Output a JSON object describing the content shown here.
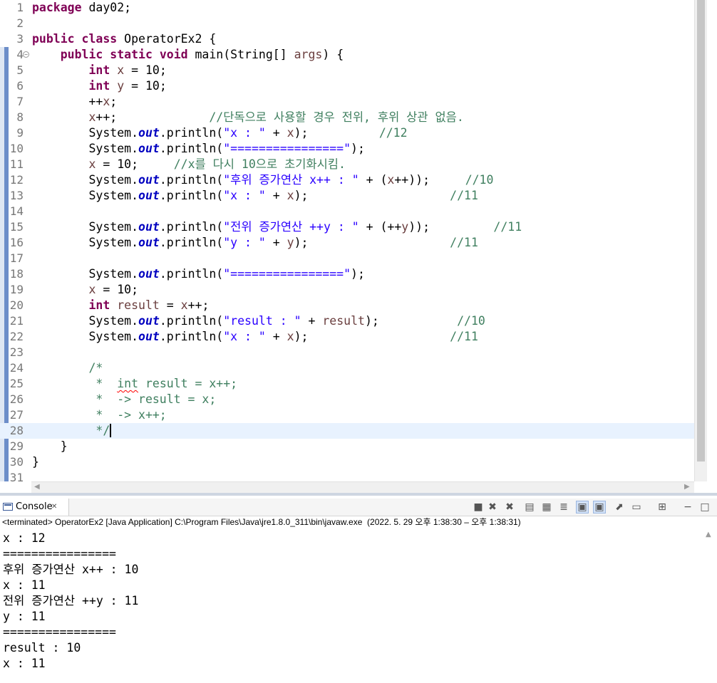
{
  "editor": {
    "lines": [
      {
        "n": "1",
        "segs": [
          [
            "kw",
            "package"
          ],
          [
            "p",
            " day02;"
          ]
        ]
      },
      {
        "n": "2",
        "segs": []
      },
      {
        "n": "3",
        "segs": [
          [
            "kw",
            "public class"
          ],
          [
            "p",
            " OperatorEx2 {"
          ]
        ]
      },
      {
        "n": "4",
        "fold": true,
        "segs": [
          [
            "p",
            "    "
          ],
          [
            "kw",
            "public static void"
          ],
          [
            "p",
            " main(String[] "
          ],
          [
            "var",
            "args"
          ],
          [
            "p",
            ") {"
          ]
        ]
      },
      {
        "n": "5",
        "segs": [
          [
            "p",
            "        "
          ],
          [
            "kw",
            "int"
          ],
          [
            "p",
            " "
          ],
          [
            "var",
            "x"
          ],
          [
            "p",
            " = 10;"
          ]
        ]
      },
      {
        "n": "6",
        "segs": [
          [
            "p",
            "        "
          ],
          [
            "kw",
            "int"
          ],
          [
            "p",
            " "
          ],
          [
            "var",
            "y"
          ],
          [
            "p",
            " = 10;"
          ]
        ]
      },
      {
        "n": "7",
        "segs": [
          [
            "p",
            "        ++"
          ],
          [
            "var",
            "x"
          ],
          [
            "p",
            ";"
          ]
        ]
      },
      {
        "n": "8",
        "segs": [
          [
            "p",
            "        "
          ],
          [
            "var",
            "x"
          ],
          [
            "p",
            "++;             "
          ],
          [
            "cm",
            "//단독으로 사용할 경우 전위, 후위 상관 없음."
          ]
        ]
      },
      {
        "n": "9",
        "segs": [
          [
            "p",
            "        System."
          ],
          [
            "fld",
            "out"
          ],
          [
            "p",
            ".println("
          ],
          [
            "str",
            "\"x : \""
          ],
          [
            "p",
            " + "
          ],
          [
            "var",
            "x"
          ],
          [
            "p",
            ");          "
          ],
          [
            "cm",
            "//12"
          ]
        ]
      },
      {
        "n": "10",
        "segs": [
          [
            "p",
            "        System."
          ],
          [
            "fld",
            "out"
          ],
          [
            "p",
            ".println("
          ],
          [
            "str",
            "\"================\""
          ],
          [
            "p",
            ");"
          ]
        ]
      },
      {
        "n": "11",
        "segs": [
          [
            "p",
            "        "
          ],
          [
            "var",
            "x"
          ],
          [
            "p",
            " = 10;     "
          ],
          [
            "cm",
            "//x를 다시 10으로 초기화시킴."
          ]
        ]
      },
      {
        "n": "12",
        "segs": [
          [
            "p",
            "        System."
          ],
          [
            "fld",
            "out"
          ],
          [
            "p",
            ".println("
          ],
          [
            "str",
            "\"후위 증가연산 x++ : \""
          ],
          [
            "p",
            " + ("
          ],
          [
            "var",
            "x"
          ],
          [
            "p",
            "++));     "
          ],
          [
            "cm",
            "//10"
          ]
        ]
      },
      {
        "n": "13",
        "segs": [
          [
            "p",
            "        System."
          ],
          [
            "fld",
            "out"
          ],
          [
            "p",
            ".println("
          ],
          [
            "str",
            "\"x : \""
          ],
          [
            "p",
            " + "
          ],
          [
            "var",
            "x"
          ],
          [
            "p",
            ");                    "
          ],
          [
            "cm",
            "//11"
          ]
        ]
      },
      {
        "n": "14",
        "segs": []
      },
      {
        "n": "15",
        "segs": [
          [
            "p",
            "        System."
          ],
          [
            "fld",
            "out"
          ],
          [
            "p",
            ".println("
          ],
          [
            "str",
            "\"전위 증가연산 ++y : \""
          ],
          [
            "p",
            " + (++"
          ],
          [
            "var",
            "y"
          ],
          [
            "p",
            "));         "
          ],
          [
            "cm",
            "//11"
          ]
        ]
      },
      {
        "n": "16",
        "segs": [
          [
            "p",
            "        System."
          ],
          [
            "fld",
            "out"
          ],
          [
            "p",
            ".println("
          ],
          [
            "str",
            "\"y : \""
          ],
          [
            "p",
            " + "
          ],
          [
            "var",
            "y"
          ],
          [
            "p",
            ");                    "
          ],
          [
            "cm",
            "//11"
          ]
        ]
      },
      {
        "n": "17",
        "segs": []
      },
      {
        "n": "18",
        "segs": [
          [
            "p",
            "        System."
          ],
          [
            "fld",
            "out"
          ],
          [
            "p",
            ".println("
          ],
          [
            "str",
            "\"================\""
          ],
          [
            "p",
            ");"
          ]
        ]
      },
      {
        "n": "19",
        "segs": [
          [
            "p",
            "        "
          ],
          [
            "var",
            "x"
          ],
          [
            "p",
            " = 10;"
          ]
        ]
      },
      {
        "n": "20",
        "segs": [
          [
            "p",
            "        "
          ],
          [
            "kw",
            "int"
          ],
          [
            "p",
            " "
          ],
          [
            "var",
            "result"
          ],
          [
            "p",
            " = "
          ],
          [
            "var",
            "x"
          ],
          [
            "p",
            "++;"
          ]
        ]
      },
      {
        "n": "21",
        "segs": [
          [
            "p",
            "        System."
          ],
          [
            "fld",
            "out"
          ],
          [
            "p",
            ".println("
          ],
          [
            "str",
            "\"result : \""
          ],
          [
            "p",
            " + "
          ],
          [
            "var",
            "result"
          ],
          [
            "p",
            ");           "
          ],
          [
            "cm",
            "//10"
          ]
        ]
      },
      {
        "n": "22",
        "segs": [
          [
            "p",
            "        System."
          ],
          [
            "fld",
            "out"
          ],
          [
            "p",
            ".println("
          ],
          [
            "str",
            "\"x : \""
          ],
          [
            "p",
            " + "
          ],
          [
            "var",
            "x"
          ],
          [
            "p",
            ");                    "
          ],
          [
            "cm",
            "//11"
          ]
        ]
      },
      {
        "n": "23",
        "segs": []
      },
      {
        "n": "24",
        "segs": [
          [
            "p",
            "        "
          ],
          [
            "cm",
            "/*"
          ]
        ]
      },
      {
        "n": "25",
        "segs": [
          [
            "p",
            "         "
          ],
          [
            "cm",
            "*  "
          ],
          [
            "cmsq",
            "int"
          ],
          [
            "cm",
            " result = x++;"
          ]
        ]
      },
      {
        "n": "26",
        "segs": [
          [
            "p",
            "         "
          ],
          [
            "cm",
            "*  -> result = x;"
          ]
        ]
      },
      {
        "n": "27",
        "segs": [
          [
            "p",
            "         "
          ],
          [
            "cm",
            "*  -> x++;"
          ]
        ]
      },
      {
        "n": "28",
        "current": true,
        "segs": [
          [
            "p",
            "         "
          ],
          [
            "cm",
            "*/"
          ],
          [
            "caret",
            ""
          ]
        ]
      },
      {
        "n": "29",
        "segs": [
          [
            "p",
            "    }"
          ]
        ]
      },
      {
        "n": "30",
        "segs": [
          [
            "p",
            "}"
          ]
        ]
      },
      {
        "n": "31",
        "segs": []
      }
    ]
  },
  "console": {
    "tab_label": "Console",
    "description": "<terminated> OperatorEx2 [Java Application] C:\\Program Files\\Java\\jre1.8.0_311\\bin\\javaw.exe  (2022. 5. 29 오후 1:38:30 – 오후 1:38:31)",
    "output": [
      "x : 12",
      "================",
      "후위 증가연산 x++ : 10",
      "x : 11",
      "전위 증가연산 ++y : 11",
      "y : 11",
      "================",
      "result : 10",
      "x : 11"
    ],
    "toolbar_icons": [
      "terminate-icon",
      "remove-launch-icon",
      "remove-all-terminated-icon",
      "clear-console-icon",
      "scroll-lock-icon",
      "word-wrap-icon",
      "show-on-stdout-icon",
      "show-on-stderr-icon",
      "pin-console-icon",
      "display-selected-console-icon",
      "open-console-icon",
      "minimize-icon",
      "maximize-icon"
    ]
  }
}
